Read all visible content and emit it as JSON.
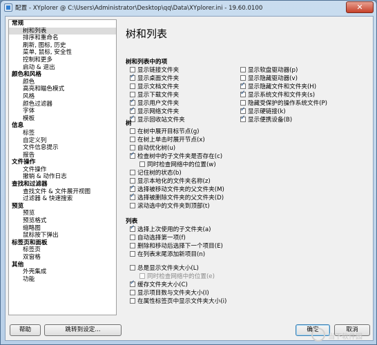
{
  "window": {
    "title": "配置 - XYplorer @ C:\\Users\\Administrator\\Desktop\\qq\\Data\\XYplorer.ini - 19.60.0100",
    "close": "✕"
  },
  "nav": {
    "items": [
      {
        "label": "常规",
        "type": "cat"
      },
      {
        "label": "树和列表",
        "type": "sub",
        "selected": true
      },
      {
        "label": "排序和重命名",
        "type": "sub"
      },
      {
        "label": "刷新, 图标, 历史",
        "type": "sub"
      },
      {
        "label": "菜单, 鼠标, 安全性",
        "type": "sub"
      },
      {
        "label": "控制和更多",
        "type": "sub"
      },
      {
        "label": "启动 & 退出",
        "type": "sub"
      },
      {
        "label": "颜色和风格",
        "type": "cat"
      },
      {
        "label": "颜色",
        "type": "sub"
      },
      {
        "label": "高亮和瞄色模式",
        "type": "sub"
      },
      {
        "label": "风格",
        "type": "sub"
      },
      {
        "label": "颜色过滤器",
        "type": "sub"
      },
      {
        "label": "字体",
        "type": "sub"
      },
      {
        "label": "模板",
        "type": "sub"
      },
      {
        "label": "信息",
        "type": "cat"
      },
      {
        "label": "标签",
        "type": "sub"
      },
      {
        "label": "自定义列",
        "type": "sub"
      },
      {
        "label": "文件信息提示",
        "type": "sub"
      },
      {
        "label": "报告",
        "type": "sub"
      },
      {
        "label": "文件操作",
        "type": "cat"
      },
      {
        "label": "文件操作",
        "type": "sub"
      },
      {
        "label": "撤销 & 动作日志",
        "type": "sub"
      },
      {
        "label": "查找和过滤器",
        "type": "cat"
      },
      {
        "label": "查找文件 & 文件展开视图",
        "type": "sub"
      },
      {
        "label": "过滤器 & 快速搜索",
        "type": "sub"
      },
      {
        "label": "预览",
        "type": "cat"
      },
      {
        "label": "预览",
        "type": "sub"
      },
      {
        "label": "预览格式",
        "type": "sub"
      },
      {
        "label": "缩略图",
        "type": "sub"
      },
      {
        "label": "鼠标按下弹出",
        "type": "sub"
      },
      {
        "label": "标签页和面板",
        "type": "cat"
      },
      {
        "label": "标签页",
        "type": "sub"
      },
      {
        "label": "双窗格",
        "type": "sub"
      },
      {
        "label": "其他",
        "type": "cat"
      },
      {
        "label": "外壳集成",
        "type": "sub"
      },
      {
        "label": "功能",
        "type": "sub"
      }
    ]
  },
  "main": {
    "title": "树和列表",
    "section1": {
      "title": "树和列表中的项",
      "left": [
        {
          "label": "显示链接文件夹",
          "checked": false
        },
        {
          "label": "显示桌面文件夹",
          "checked": true
        },
        {
          "label": "显示文档文件夹",
          "checked": false
        },
        {
          "label": "显示下载文件夹",
          "checked": false
        },
        {
          "label": "显示用户文件夹",
          "checked": true
        },
        {
          "label": "显示网络文件夹",
          "checked": true
        },
        {
          "label": "显示回收站文件夹",
          "checked": true
        }
      ],
      "right": [
        {
          "label": "显示软盘驱动器(p)",
          "checked": false
        },
        {
          "label": "显示隐藏驱动器(v)",
          "checked": false
        },
        {
          "label": "显示隐藏文件和文件夹(H)",
          "checked": true
        },
        {
          "label": "显示系统文件和文件夹(s)",
          "checked": true
        },
        {
          "label": "隐藏受保护的操作系统文件(P)",
          "checked": false
        },
        {
          "label": "显示硬链接(k)",
          "checked": true
        },
        {
          "label": "显示便携设备(B)",
          "checked": true
        }
      ]
    },
    "section2": {
      "title": "树",
      "items": [
        {
          "label": "在树中展开目标节点(g)",
          "checked": false,
          "indent": false,
          "disabled": false
        },
        {
          "label": "在树上单击时展开节点(x)",
          "checked": false,
          "indent": false,
          "disabled": false
        },
        {
          "label": "自动优化树(u)",
          "checked": false,
          "indent": false,
          "disabled": false
        },
        {
          "label": "检查树中的子文件夹是否存在(c)",
          "checked": true,
          "indent": false,
          "disabled": false
        },
        {
          "label": "同时检查网络中的位置(w)",
          "checked": false,
          "indent": true,
          "disabled": false
        },
        {
          "label": "记住树的状态(b)",
          "checked": false,
          "indent": false,
          "disabled": false
        },
        {
          "label": "显示本地化的文件夹名称(z)",
          "checked": false,
          "indent": false,
          "disabled": false
        },
        {
          "label": "选择被移动文件夹的父文件夹(M)",
          "checked": true,
          "indent": false,
          "disabled": false
        },
        {
          "label": "选择被删除文件夹的父文件夹(D)",
          "checked": true,
          "indent": false,
          "disabled": false
        },
        {
          "label": "滚动选中的文件夹到顶部(t)",
          "checked": false,
          "indent": false,
          "disabled": false
        }
      ]
    },
    "section3": {
      "title": "列表",
      "items": [
        {
          "label": "选择上次使用的子文件夹(a)",
          "checked": true,
          "indent": false,
          "disabled": false
        },
        {
          "label": "自动选择第一项(f)",
          "checked": false,
          "indent": false,
          "disabled": false
        },
        {
          "label": "删除和移动后选择下一个项目(E)",
          "checked": false,
          "indent": false,
          "disabled": false
        },
        {
          "label": "在列表末尾添加新项目(n)",
          "checked": false,
          "indent": false,
          "disabled": false
        },
        {
          "label": "总是显示文件夹大小(L)",
          "checked": false,
          "indent": false,
          "disabled": false
        },
        {
          "label": "同时检查网络中的位置(e)",
          "checked": false,
          "indent": true,
          "disabled": true
        },
        {
          "label": "缓存文件夹大小(C)",
          "checked": true,
          "indent": false,
          "disabled": false
        },
        {
          "label": "显示项目数与文件夹大小(I)",
          "checked": false,
          "indent": false,
          "disabled": false
        },
        {
          "label": "在属性标签页中显示文件夹大小(i)",
          "checked": false,
          "indent": false,
          "disabled": false
        }
      ]
    }
  },
  "footer": {
    "help": "帮助",
    "jump": "跳转到设定...",
    "ok": "确定",
    "cancel": "取消",
    "watermark": "当下软件园"
  }
}
